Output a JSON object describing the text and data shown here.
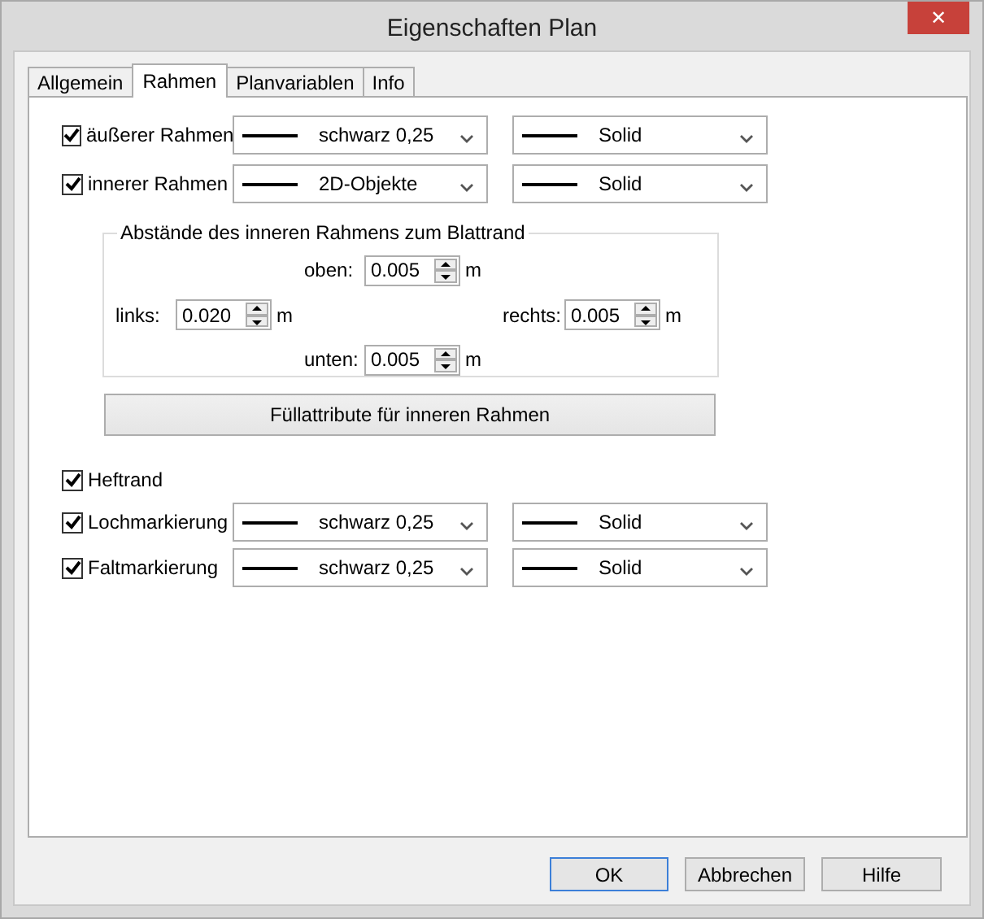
{
  "window": {
    "title": "Eigenschaften Plan",
    "close": "✕"
  },
  "tabs": [
    {
      "label": "Allgemein",
      "selected": false
    },
    {
      "label": "Rahmen",
      "selected": true
    },
    {
      "label": "Planvariablen",
      "selected": false
    },
    {
      "label": "Info",
      "selected": false
    }
  ],
  "frame_rows": [
    {
      "kind": "line",
      "label": "äußerer Rahmen",
      "checked": true,
      "pen": "schwarz 0,25",
      "style": "Solid"
    },
    {
      "kind": "line",
      "label": "innerer Rahmen",
      "checked": true,
      "pen": "2D-Objekte",
      "style": "Solid"
    }
  ],
  "spacing": {
    "title": "Abstände des inneren Rahmens zum Blattrand",
    "fields": [
      {
        "kind": "top",
        "label": "oben:",
        "value": "0.005",
        "unit": "m"
      },
      {
        "kind": "left",
        "label": "links:",
        "value": "0.020",
        "unit": "m"
      },
      {
        "kind": "right",
        "label": "rechts:",
        "value": "0.005",
        "unit": "m"
      },
      {
        "kind": "bottom",
        "label": "unten:",
        "value": "0.005",
        "unit": "m"
      }
    ]
  },
  "fill_button": "Füllattribute für inneren Rahmen",
  "mark_rows": [
    {
      "kind": "checkbox",
      "label": "Heftrand",
      "checked": true
    },
    {
      "kind": "line",
      "label": "Lochmarkierung",
      "checked": true,
      "pen": "schwarz 0,25",
      "style": "Solid"
    },
    {
      "kind": "line",
      "label": "Faltmarkierung",
      "checked": true,
      "pen": "schwarz 0,25",
      "style": "Solid"
    }
  ],
  "buttons": [
    {
      "label": "OK",
      "focused": true
    },
    {
      "label": "Abbrechen",
      "focused": false
    },
    {
      "label": "Hilfe",
      "focused": false
    }
  ]
}
